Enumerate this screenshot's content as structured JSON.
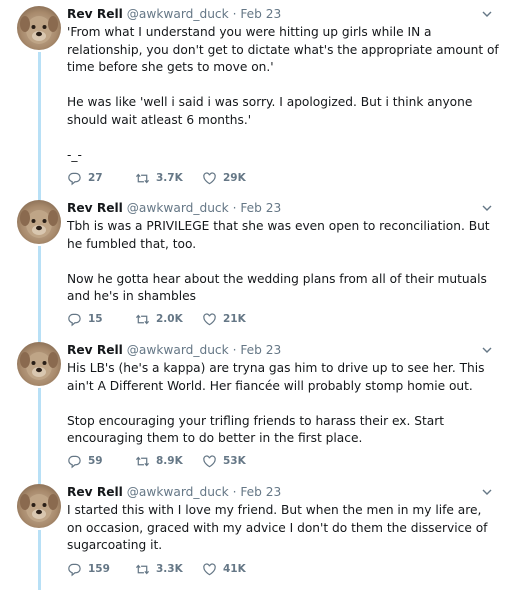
{
  "tweets": [
    {
      "name": "Rev Rell",
      "handle": "@awkward_duck",
      "separator": "·",
      "date": "Feb 23",
      "paragraphs": [
        "'From what I understand you were hitting up girls while IN a relationship, you don't get to dictate what's the appropriate amount of time before she gets to move on.'",
        "He was like 'well i said i was sorry. I apologized. But i think anyone should wait atleast 6 months.'",
        "-_-"
      ],
      "replies": "27",
      "retweets": "3.7K",
      "likes": "29K"
    },
    {
      "name": "Rev Rell",
      "handle": "@awkward_duck",
      "separator": "·",
      "date": "Feb 23",
      "paragraphs": [
        "Tbh is was a PRIVILEGE that she was even open to reconciliation. But he fumbled that, too.",
        "Now he gotta hear about the wedding plans from all of their mutuals and he's in shambles"
      ],
      "replies": "15",
      "retweets": "2.0K",
      "likes": "21K"
    },
    {
      "name": "Rev Rell",
      "handle": "@awkward_duck",
      "separator": "·",
      "date": "Feb 23",
      "paragraphs": [
        "His LB's (he's a kappa) are tryna gas him to drive up to see her. This ain't A Different World. Her fiancée will probably stomp homie out.",
        "Stop encouraging your trifling friends to harass their ex. Start encouraging them to do better in the first place."
      ],
      "replies": "59",
      "retweets": "8.9K",
      "likes": "53K"
    },
    {
      "name": "Rev Rell",
      "handle": "@awkward_duck",
      "separator": "·",
      "date": "Feb 23",
      "paragraphs": [
        "I started this with I love my friend. But when the men in my life are, on occasion, graced with my advice I don't do them the disservice of sugarcoating it."
      ],
      "replies": "159",
      "retweets": "3.3K",
      "likes": "41K"
    }
  ],
  "icons": {
    "avatar": "dog-avatar",
    "caret": "chevron-down-icon",
    "reply": "reply-icon",
    "retweet": "retweet-icon",
    "like": "heart-icon"
  },
  "colors": {
    "text": "#14171a",
    "muted": "#657786",
    "thread_line": "#b8e0f6"
  }
}
